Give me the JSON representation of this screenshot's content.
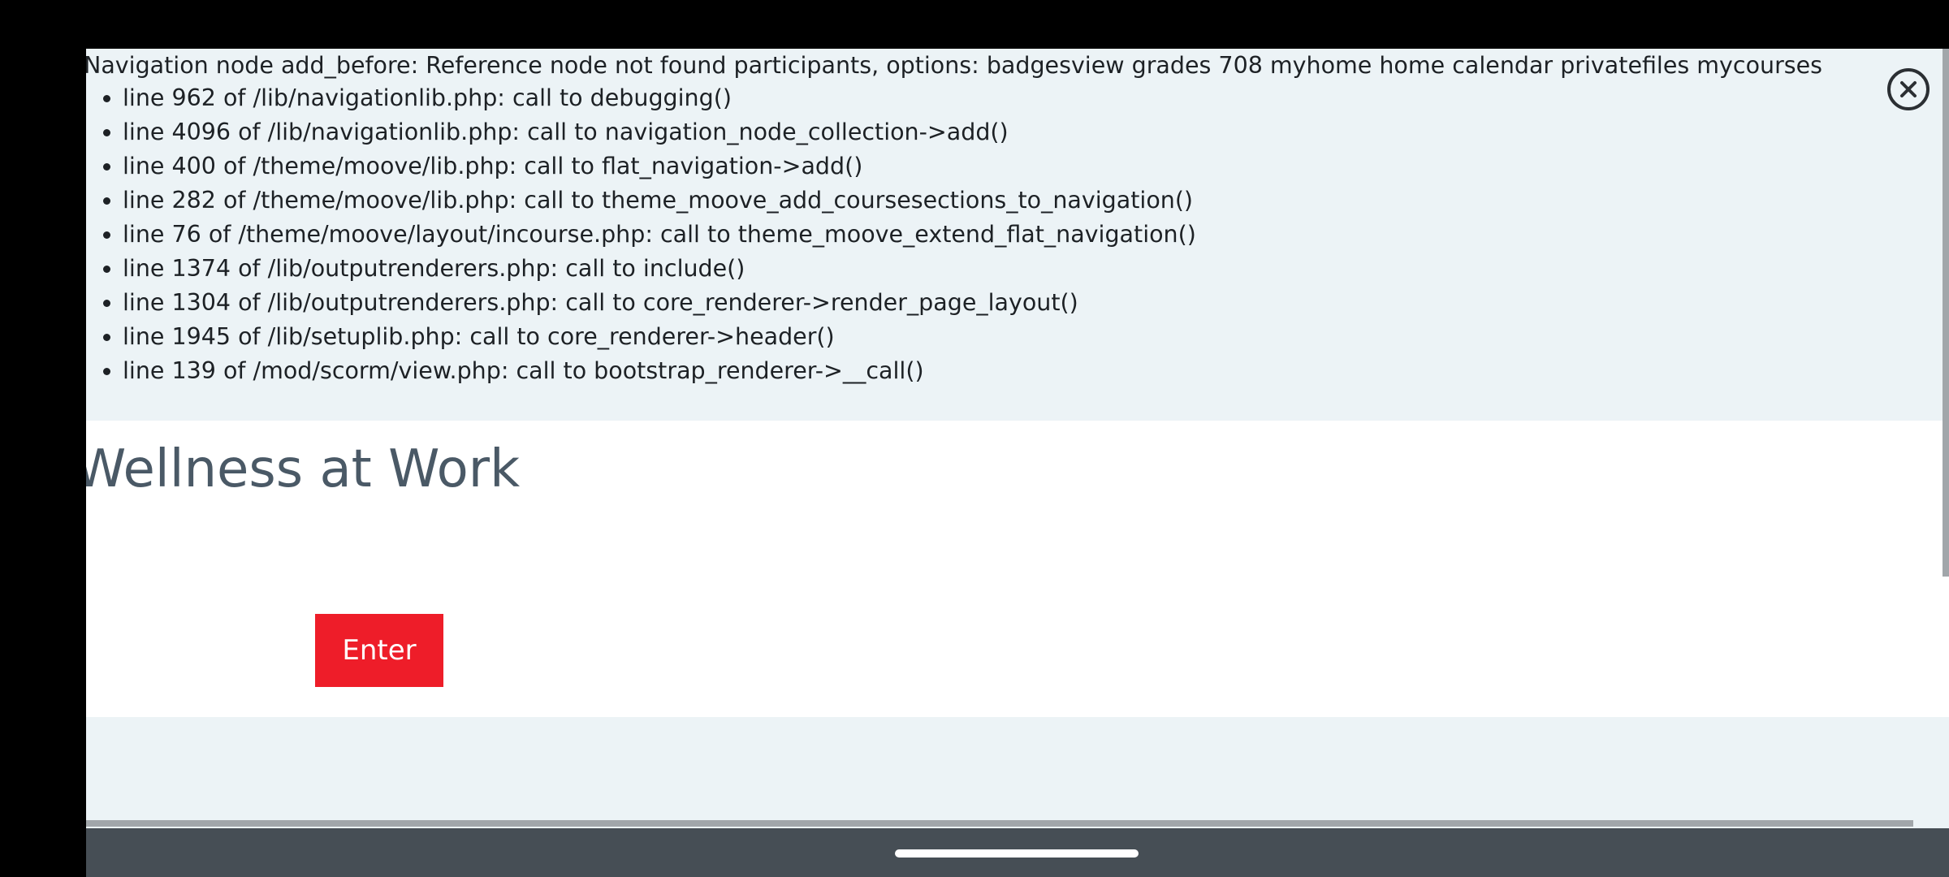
{
  "debug": {
    "message": "Navigation node add_before: Reference node not found participants, options: badgesview grades 708 myhome home calendar privatefiles mycourses",
    "trace": [
      "line 962 of /lib/navigationlib.php: call to debugging()",
      "line 4096 of /lib/navigationlib.php: call to navigation_node_collection->add()",
      "line 400 of /theme/moove/lib.php: call to flat_navigation->add()",
      "line 282 of /theme/moove/lib.php: call to theme_moove_add_coursesections_to_navigation()",
      "line 76 of /theme/moove/layout/incourse.php: call to theme_moove_extend_flat_navigation()",
      "line 1374 of /lib/outputrenderers.php: call to include()",
      "line 1304 of /lib/outputrenderers.php: call to core_renderer->render_page_layout()",
      "line 1945 of /lib/setuplib.php: call to core_renderer->header()",
      "line 139 of /mod/scorm/view.php: call to bootstrap_renderer->__call()"
    ]
  },
  "page": {
    "title": "Wellness at Work",
    "enter_button": "Enter"
  },
  "controls": {
    "close_icon": "close-circle-icon"
  },
  "colors": {
    "debug_background": "#ecf3f6",
    "title_color": "#4a5966",
    "enter_button_background": "#ee1d29",
    "nav_bar_background": "#464e55"
  }
}
